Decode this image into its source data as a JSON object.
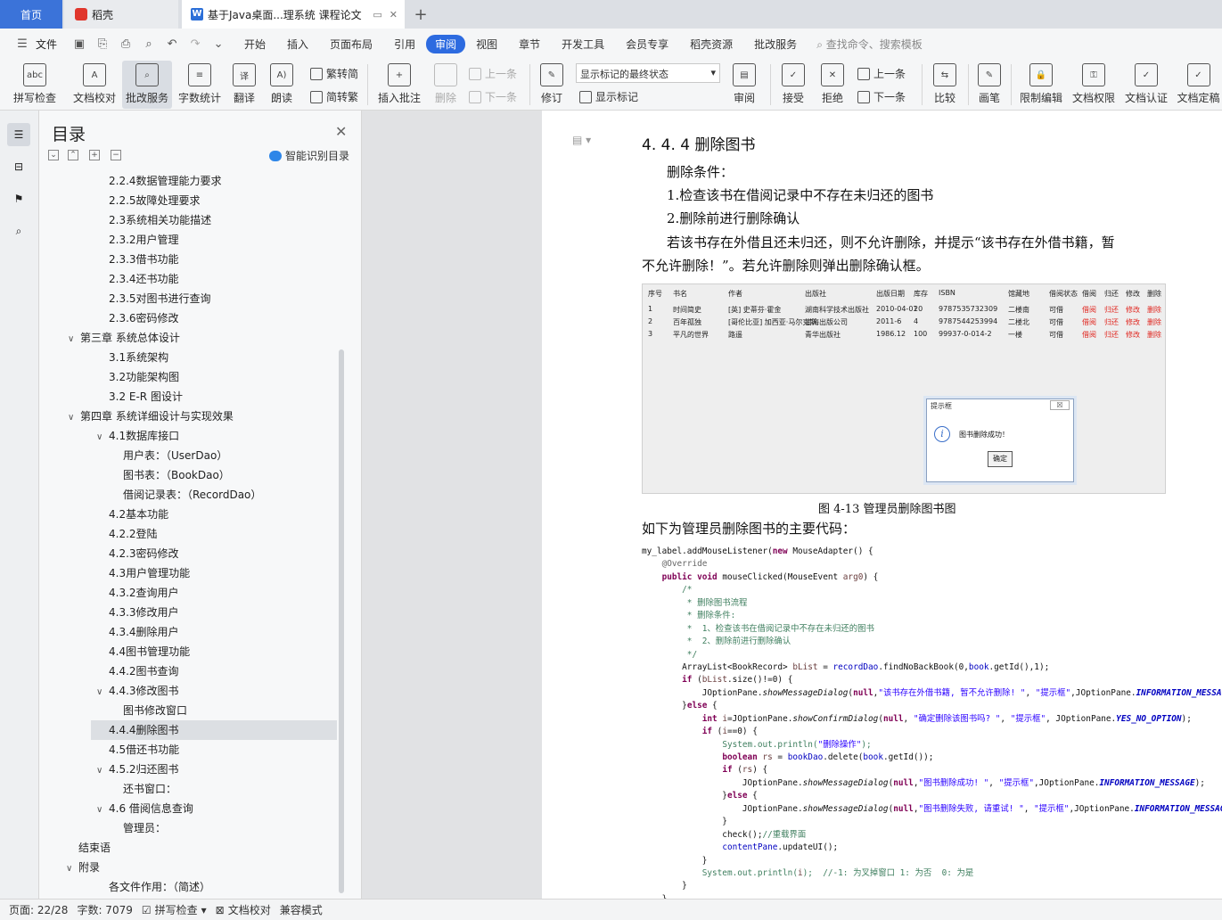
{
  "tabs": {
    "home": "首页",
    "docer": "稻壳",
    "document": "基于Java桌面...理系统 课程论文",
    "add": "+"
  },
  "menu": {
    "file": "文件",
    "items": [
      "开始",
      "插入",
      "页面布局",
      "引用",
      "审阅",
      "视图",
      "章节",
      "开发工具",
      "会员专享",
      "稻壳资源",
      "批改服务"
    ],
    "active": "审阅",
    "search_placeholder": "查找命令、搜索模板"
  },
  "ribbon": {
    "spellcheck": "拼写检查",
    "doc_proof": "文档校对",
    "correction_service": "批改服务",
    "word_count": "字数统计",
    "translate": "翻译",
    "read_aloud": "朗读",
    "trad_to_simp": "繁转简",
    "simp_to_trad": "简转繁",
    "insert_comment": "插入批注",
    "delete": "删除",
    "prev_comment": "上一条",
    "next_comment": "下一条",
    "track_changes": "修订",
    "markup_state": "显示标记的最终状态",
    "show_markup": "显示标记",
    "review": "审阅",
    "accept": "接受",
    "reject": "拒绝",
    "prev_change": "上一条",
    "next_change": "下一条",
    "compare": "比较",
    "pen": "画笔",
    "restrict_edit": "限制编辑",
    "doc_permission": "文档权限",
    "doc_certify": "文档认证",
    "doc_finalize": "文档定稿"
  },
  "toc": {
    "title": "目录",
    "smart": "智能识别目录",
    "items": [
      {
        "text": "2.2.4数据管理能力要求",
        "level": 2
      },
      {
        "text": "2.2.5故障处理要求",
        "level": 2
      },
      {
        "text": "2.3系统相关功能描述",
        "level": 2
      },
      {
        "text": "2.3.2用户管理",
        "level": 2
      },
      {
        "text": "2.3.3借书功能",
        "level": 2
      },
      {
        "text": "2.3.4还书功能",
        "level": 2
      },
      {
        "text": "2.3.5对图书进行查询",
        "level": 2
      },
      {
        "text": "2.3.6密码修改",
        "level": 2
      },
      {
        "text": "第三章  系统总体设计",
        "level": 1,
        "caret": "∨"
      },
      {
        "text": "3.1系统架构",
        "level": 2
      },
      {
        "text": "3.2功能架构图",
        "level": 2
      },
      {
        "text": "3.2 E-R 图设计",
        "level": 2
      },
      {
        "text": "第四章  系统详细设计与实现效果",
        "level": 1,
        "caret": "∨"
      },
      {
        "text": "4.1数据库接口",
        "level": 2,
        "caret": "∨"
      },
      {
        "text": "用户表：（UserDao）",
        "level": 3
      },
      {
        "text": "图书表：（BookDao）",
        "level": 3
      },
      {
        "text": "借阅记录表：（RecordDao）",
        "level": 3
      },
      {
        "text": "4.2基本功能",
        "level": 2
      },
      {
        "text": "4.2.2登陆",
        "level": 2
      },
      {
        "text": "4.2.3密码修改",
        "level": 2
      },
      {
        "text": "4.3用户管理功能",
        "level": 2
      },
      {
        "text": "4.3.2查询用户",
        "level": 2
      },
      {
        "text": "4.3.3修改用户",
        "level": 2
      },
      {
        "text": "4.3.4删除用户",
        "level": 2
      },
      {
        "text": "4.4图书管理功能",
        "level": 2
      },
      {
        "text": "4.4.2图书查询",
        "level": 2
      },
      {
        "text": "4.4.3修改图书",
        "level": 2,
        "caret": "∨"
      },
      {
        "text": "图书修改窗口",
        "level": 3
      },
      {
        "text": "4.4.4删除图书",
        "level": 2,
        "selected": true
      },
      {
        "text": "4.5借还书功能",
        "level": 2
      },
      {
        "text": "4.5.2归还图书",
        "level": 2,
        "caret": "∨"
      },
      {
        "text": "还书窗口：",
        "level": 3
      },
      {
        "text": "4.6 借阅信息查询",
        "level": 2,
        "caret": "∨"
      },
      {
        "text": "管理员：",
        "level": 3
      },
      {
        "text": "结束语",
        "level": 0
      },
      {
        "text": "附录",
        "level": 0,
        "caret": "∨"
      },
      {
        "text": "各文件作用：（简述）",
        "level": 2
      }
    ]
  },
  "document": {
    "section_title": "4. 4. 4 删除图书",
    "paragraphs": [
      "删除条件：",
      "1.检查该书在借阅记录中不存在未归还的图书",
      "2.删除前进行删除确认",
      "若该书存在外借且还未归还，则不允许删除，并提示“该书存在外借书籍，暂",
      "不允许删除！”。若允许删除则弹出删除确认框。"
    ],
    "figure": {
      "headers": [
        "序号",
        "书名",
        "作者",
        "出版社",
        "出版日期",
        "库存",
        "ISBN",
        "馆藏地",
        "借阅状态",
        "借阅",
        "归还",
        "修改",
        "删除"
      ],
      "rows": [
        [
          "1",
          "时间简史",
          "[英] 史蒂芬·霍金",
          "湖南科学技术出版社",
          "2010-04-01",
          "20",
          "9787535732309",
          "二楼南",
          "可借",
          "借阅",
          "归还",
          "修改",
          "删除"
        ],
        [
          "2",
          "百年孤独",
          "[哥伦比亚] 加西亚·马尔克斯",
          "南海出版公司",
          "2011-6",
          "4",
          "9787544253994",
          "二楼北",
          "可借",
          "借阅",
          "归还",
          "修改",
          "删除"
        ],
        [
          "3",
          "平凡的世界",
          "路遥",
          "青华出版社",
          "1986.12",
          "100",
          "99937-0-014-2",
          "一楼",
          "可借",
          "借阅",
          "归还",
          "修改",
          "删除"
        ]
      ],
      "dialog_title": "提示框",
      "dialog_message": "图书删除成功！",
      "dialog_ok": "确定",
      "dialog_close": "☒"
    },
    "caption": "图 4-13 管理员删除图书图",
    "intro": "如下为管理员删除图书的主要代码："
  },
  "status": {
    "page": "页面: 22/28",
    "words": "字数: 7079",
    "spellcheck": "拼写检查",
    "doc_proof": "文档校对",
    "compat": "兼容模式"
  }
}
